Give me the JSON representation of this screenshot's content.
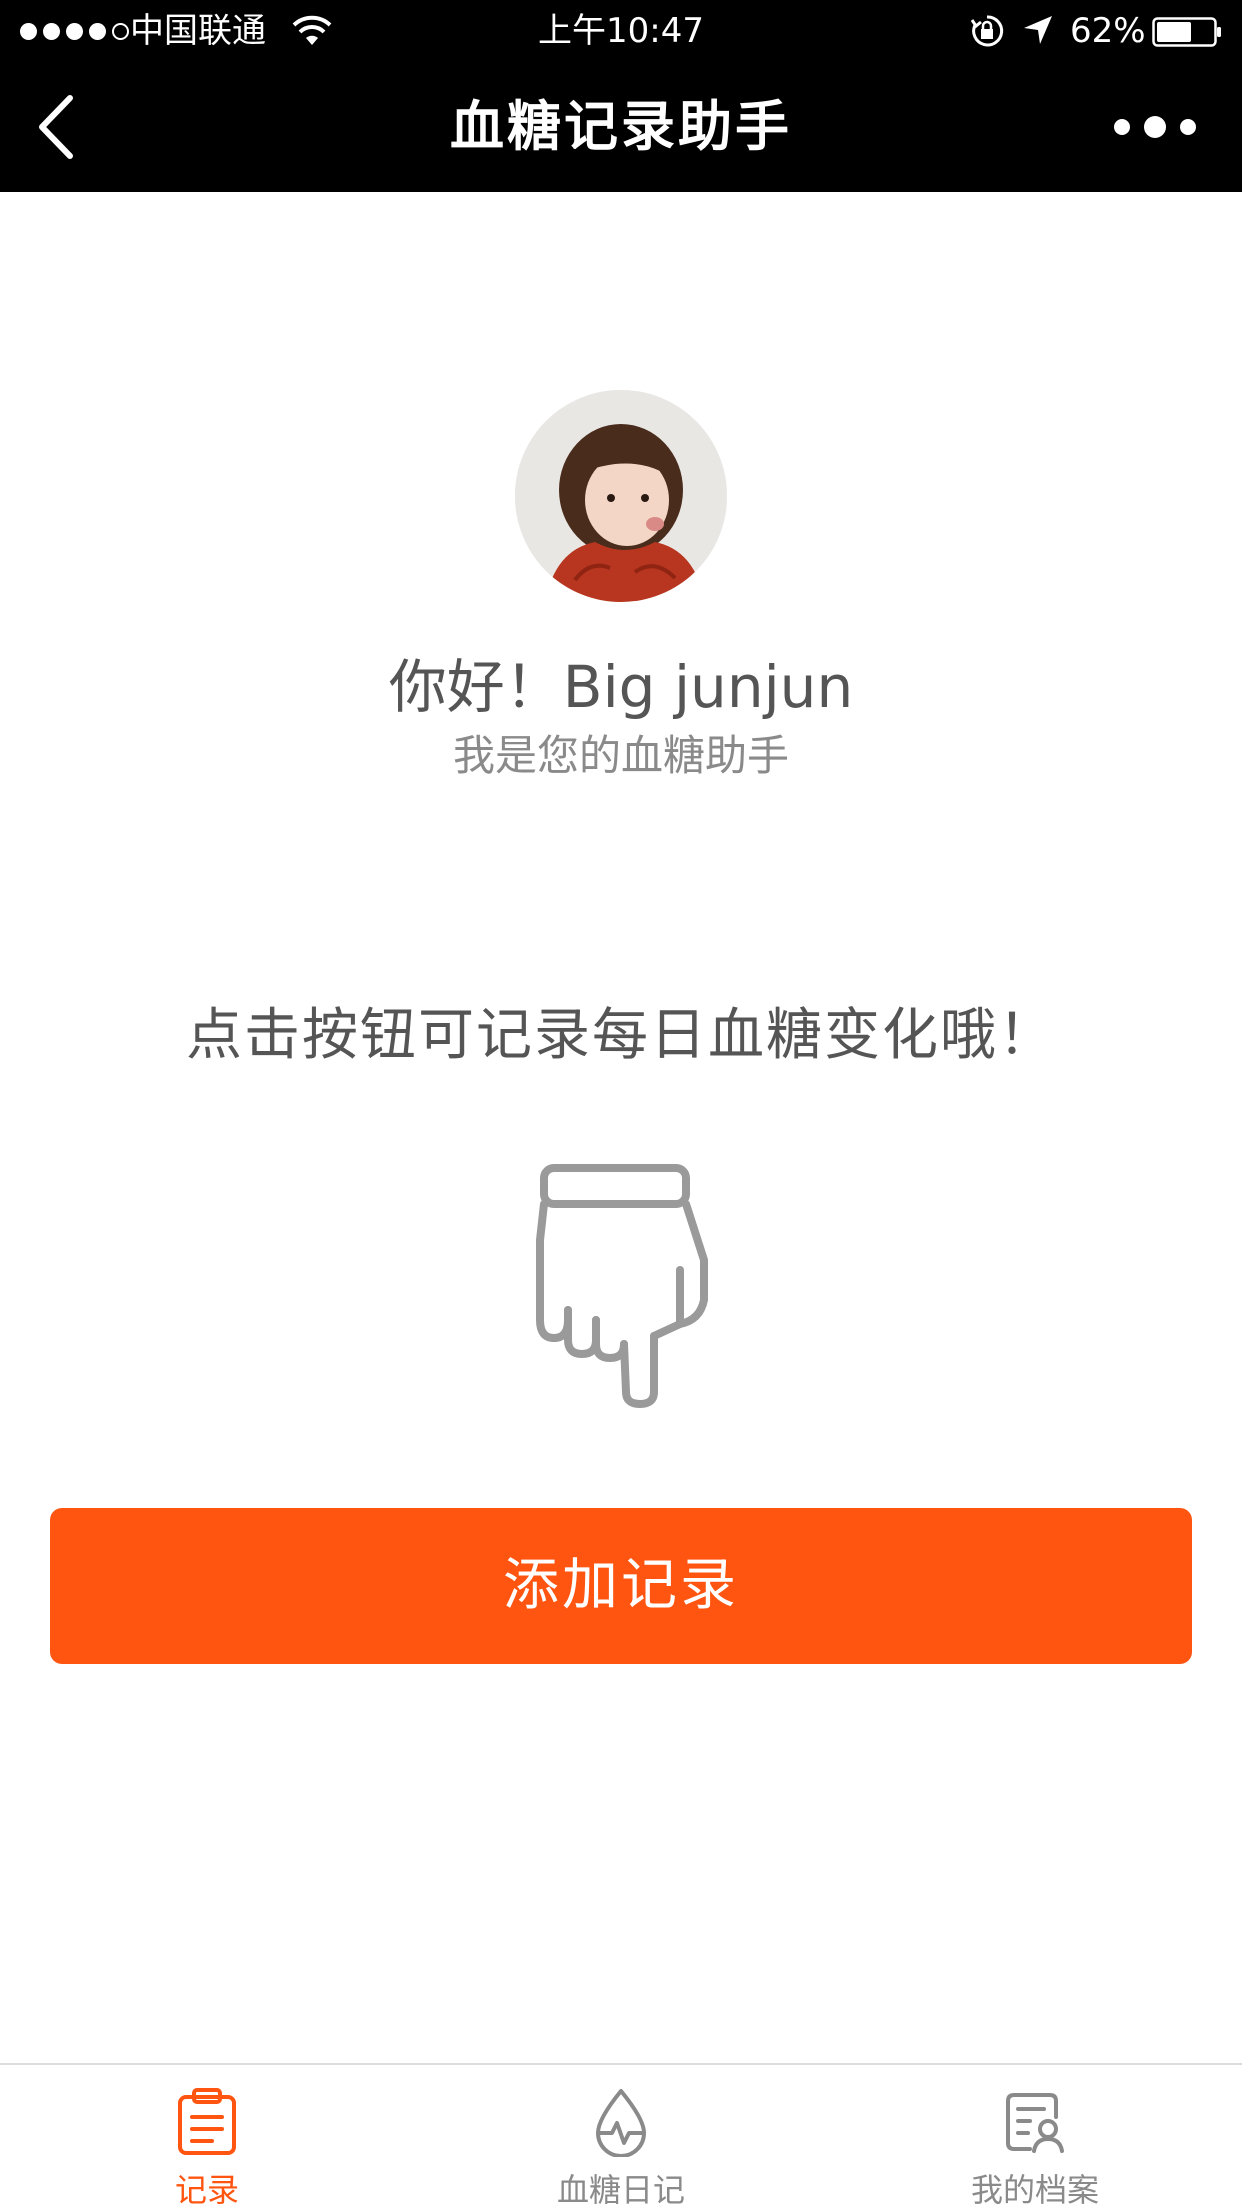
{
  "status_bar": {
    "carrier": "中国联通",
    "time": "上午10:47",
    "battery": "62%",
    "battery_level": 0.62
  },
  "nav": {
    "title": "血糖记录助手"
  },
  "profile": {
    "greeting": "你好！Big junjun",
    "subtitle": "我是您的血糖助手"
  },
  "main": {
    "instruction": "点击按钮可记录每日血糖变化哦！",
    "add_button_label": "添加记录"
  },
  "tabs": [
    {
      "label": "记录",
      "icon": "clipboard-icon",
      "active": true
    },
    {
      "label": "血糖日记",
      "icon": "blood-drop-icon",
      "active": false
    },
    {
      "label": "我的档案",
      "icon": "profile-card-icon",
      "active": false
    }
  ],
  "colors": {
    "accent": "#ff5511",
    "nav_background": "#000000",
    "tab_inactive": "#8a8a8a"
  }
}
